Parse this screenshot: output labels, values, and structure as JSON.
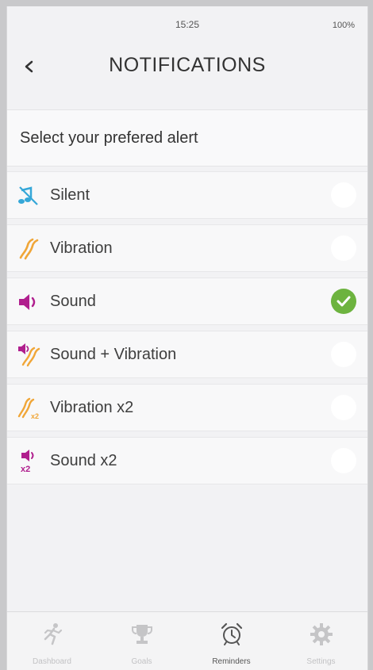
{
  "status_bar": {
    "time": "15:25",
    "battery": "100%"
  },
  "nav": {
    "title": "NOTIFICATIONS",
    "back_icon": "chevron-left-icon"
  },
  "section": {
    "header": "Select your prefered alert"
  },
  "alerts": [
    {
      "label": "Silent",
      "icon": "silent-note-icon",
      "selected": false
    },
    {
      "label": "Vibration",
      "icon": "vibration-icon",
      "selected": false
    },
    {
      "label": "Sound",
      "icon": "speaker-icon",
      "selected": true
    },
    {
      "label": "Sound  + Vibration",
      "icon": "sound-vibration-icon",
      "selected": false
    },
    {
      "label": "Vibration x2",
      "icon": "vibration-x2-icon",
      "selected": false
    },
    {
      "label": "Sound x2",
      "icon": "speaker-x2-icon",
      "selected": false
    }
  ],
  "tabs": [
    {
      "label": "Dashboard",
      "icon": "runner-icon",
      "active": false
    },
    {
      "label": "Goals",
      "icon": "trophy-icon",
      "active": false
    },
    {
      "label": "Reminders",
      "icon": "alarm-clock-icon",
      "active": true
    },
    {
      "label": "Settings",
      "icon": "gear-icon",
      "active": false
    }
  ],
  "colors": {
    "accent_check": "#6db33f",
    "silent_icon": "#35a7d8",
    "vibration_icon": "#f0a638",
    "sound_icon": "#b01f8e"
  }
}
